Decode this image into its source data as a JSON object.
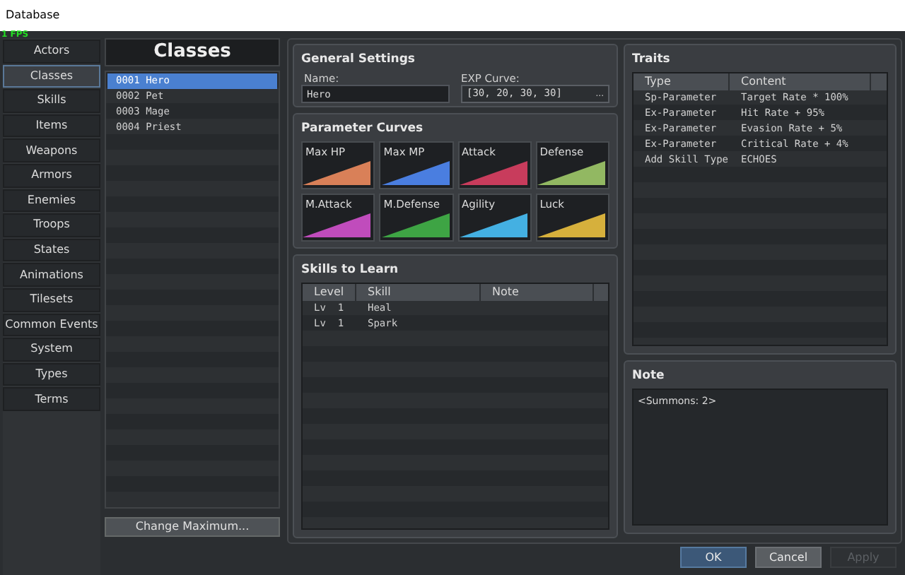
{
  "window": {
    "title": "Database"
  },
  "fps": "1 FPS",
  "nav": [
    {
      "label": "Actors",
      "selected": false
    },
    {
      "label": "Classes",
      "selected": true
    },
    {
      "label": "Skills",
      "selected": false
    },
    {
      "label": "Items",
      "selected": false
    },
    {
      "label": "Weapons",
      "selected": false
    },
    {
      "label": "Armors",
      "selected": false
    },
    {
      "label": "Enemies",
      "selected": false
    },
    {
      "label": "Troops",
      "selected": false
    },
    {
      "label": "States",
      "selected": false
    },
    {
      "label": "Animations",
      "selected": false
    },
    {
      "label": "Tilesets",
      "selected": false
    },
    {
      "label": "Common Events",
      "selected": false
    },
    {
      "label": "System",
      "selected": false
    },
    {
      "label": "Types",
      "selected": false
    },
    {
      "label": "Terms",
      "selected": false
    }
  ],
  "classes": {
    "title": "Classes",
    "items": [
      {
        "label": "0001 Hero",
        "selected": true
      },
      {
        "label": "0002 Pet",
        "selected": false
      },
      {
        "label": "0003 Mage",
        "selected": false
      },
      {
        "label": "0004 Priest",
        "selected": false
      }
    ],
    "button": "Change Maximum..."
  },
  "general": {
    "title": "General Settings",
    "name_label": "Name:",
    "name_value": "Hero",
    "exp_label": "EXP Curve:",
    "exp_value": "[30, 20, 30, 30]",
    "exp_button": "..."
  },
  "curves": {
    "title": "Parameter Curves",
    "items": [
      {
        "label": "Max HP",
        "color": "#d98058"
      },
      {
        "label": "Max MP",
        "color": "#4a7ee0"
      },
      {
        "label": "Attack",
        "color": "#c83c5c"
      },
      {
        "label": "Defense",
        "color": "#92b862"
      },
      {
        "label": "M.Attack",
        "color": "#c04cbc"
      },
      {
        "label": "M.Defense",
        "color": "#3ea444"
      },
      {
        "label": "Agility",
        "color": "#44b0e2"
      },
      {
        "label": "Luck",
        "color": "#d6b03c"
      }
    ]
  },
  "skills": {
    "title": "Skills to Learn",
    "columns": [
      "Level",
      "Skill",
      "Note"
    ],
    "rows": [
      [
        "Lv  1",
        "Heal",
        ""
      ],
      [
        "Lv  1",
        "Spark",
        ""
      ]
    ]
  },
  "traits": {
    "title": "Traits",
    "columns": [
      "Type",
      "Content"
    ],
    "rows": [
      [
        "Sp-Parameter",
        "Target Rate * 100%"
      ],
      [
        "Ex-Parameter",
        "Hit Rate + 95%"
      ],
      [
        "Ex-Parameter",
        "Evasion Rate + 5%"
      ],
      [
        "Ex-Parameter",
        "Critical Rate + 4%"
      ],
      [
        "Add Skill Type",
        "ECHOES"
      ]
    ]
  },
  "note": {
    "title": "Note",
    "value": "<Summons: 2>"
  },
  "buttons": [
    {
      "label": "OK",
      "kind": "primary",
      "disabled": false
    },
    {
      "label": "Cancel",
      "kind": "normal",
      "disabled": false
    },
    {
      "label": "Apply",
      "kind": "normal",
      "disabled": true
    }
  ]
}
